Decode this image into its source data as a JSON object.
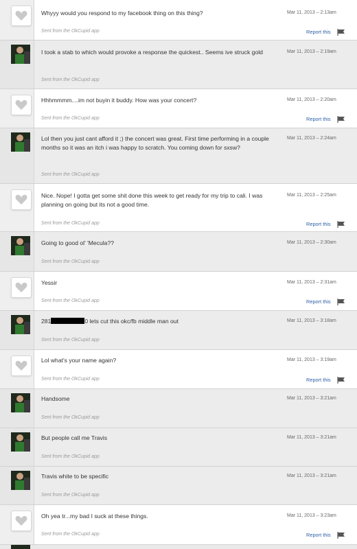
{
  "thread": {
    "via_label": "Sent from the OkCupid app",
    "report_label": "Report this",
    "messages": [
      {
        "sender": "theirs",
        "text": "Whyyy would you respond to my facebook thing on this thing?",
        "date": "Mar 11, 2013 – 2:13am"
      },
      {
        "sender": "mine",
        "text": "I took a stab to which would provoke a response the quickest.. Seems ive struck gold",
        "date": "Mar 11, 2013 – 2:19am"
      },
      {
        "sender": "theirs",
        "text": "Hhhmmmm....im not buyin it buddy. How was your concert?",
        "date": "Mar 11, 2013 – 2:20am"
      },
      {
        "sender": "mine",
        "text": "Lol then you just cant afford it ;) the concert was great. First time performing in a couple months so it was an itch i was happy to scratch. You coming down for sxsw?",
        "date": "Mar 11, 2013 – 2:24am"
      },
      {
        "sender": "theirs",
        "text": "Nice. Nope! I gotta get some shit done this week to get ready for my trip to cali. I was planning on going but its not a good time.",
        "date": "Mar 11, 2013 – 2:25am"
      },
      {
        "sender": "mine",
        "text": "Going to good ol' 'Mecula??",
        "date": "Mar 11, 2013 – 2:30am"
      },
      {
        "sender": "theirs",
        "text": "Yessir",
        "date": "Mar 11, 2013 – 2:31am"
      },
      {
        "sender": "mine",
        "text_before": "281",
        "text_after": "0 lets cut this okc/fb middle man out",
        "date": "Mar 11, 2013 – 3:18am"
      },
      {
        "sender": "theirs",
        "text": "Lol what's your name again?",
        "date": "Mar 11, 2013 – 3:19am"
      },
      {
        "sender": "mine",
        "text": "Handsome",
        "date": "Mar 11, 2013 – 3:21am"
      },
      {
        "sender": "mine",
        "text": "But people call me Travis",
        "date": "Mar 11, 2013 – 3:21am"
      },
      {
        "sender": "mine",
        "text": "Travis white to be specific",
        "date": "Mar 11, 2013 – 3:21am"
      },
      {
        "sender": "theirs",
        "text": "Oh yea tr...my bad I suck at these things.",
        "date": "Mar 11, 2013 – 3:23am"
      }
    ]
  }
}
